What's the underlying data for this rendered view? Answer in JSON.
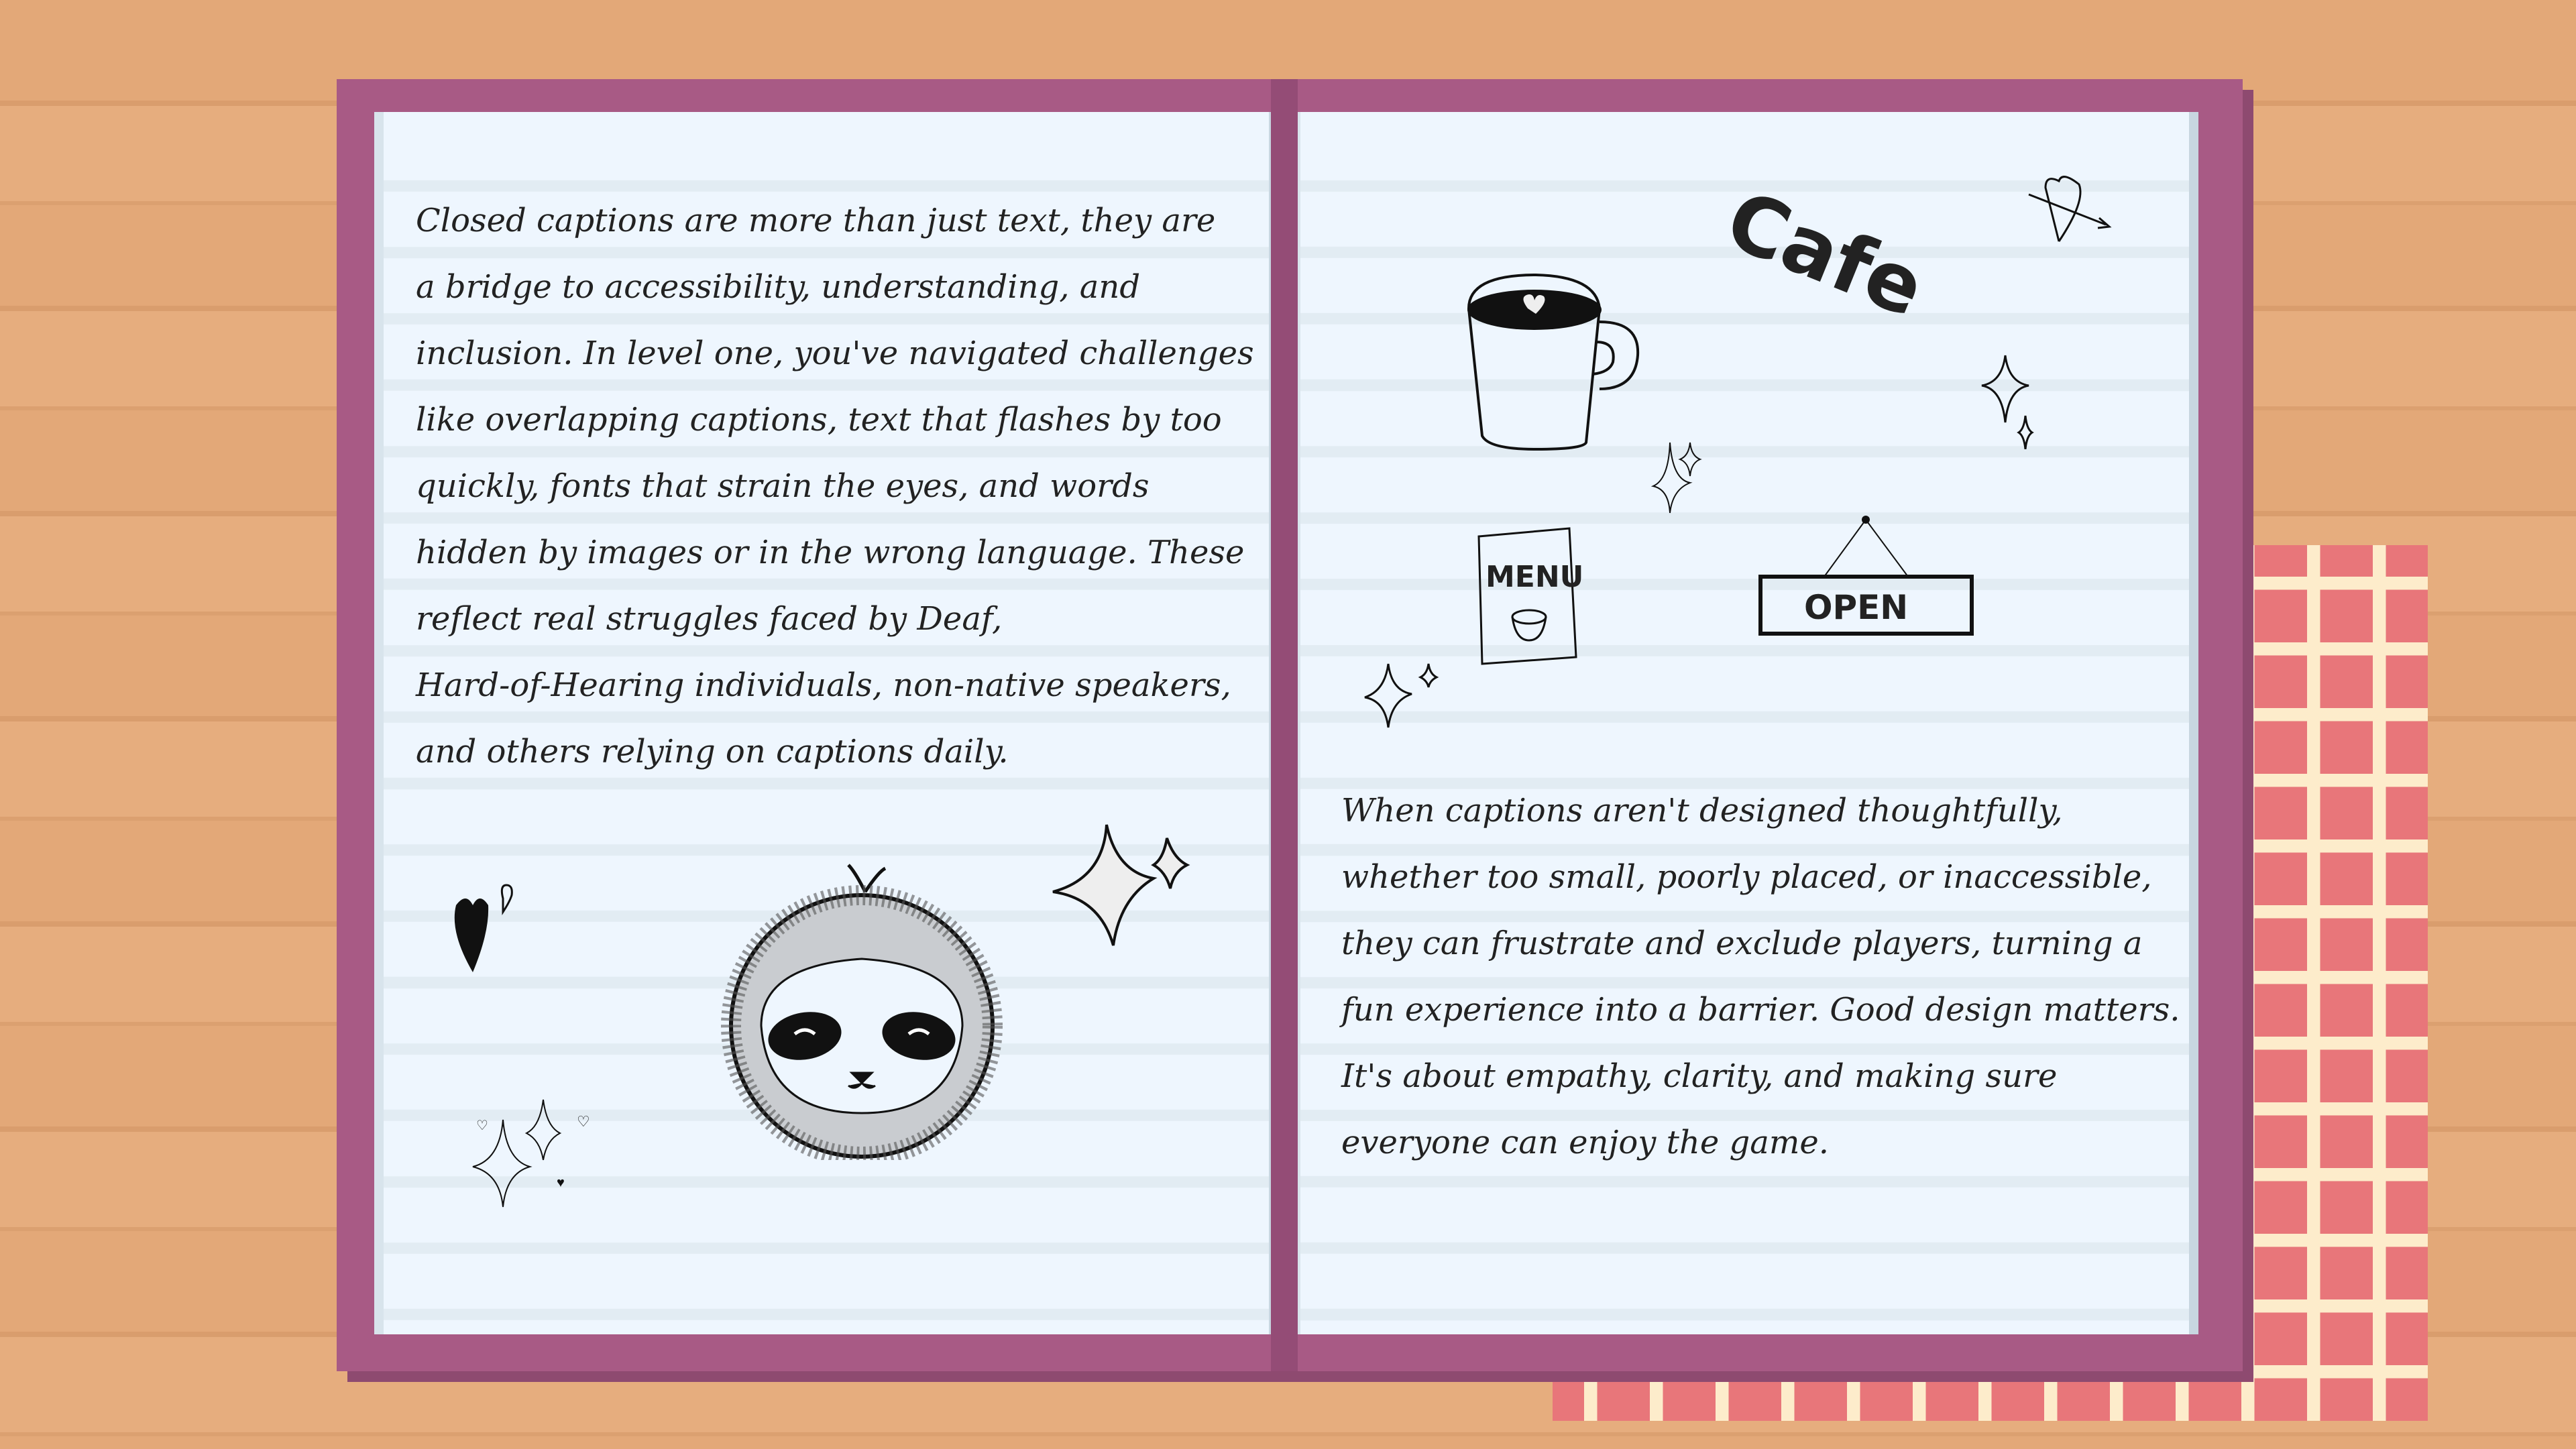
{
  "left_page": {
    "lines": [
      "Closed captions are more than just text, they are",
      "a bridge to accessibility, understanding, and",
      "inclusion. In level one, you've navigated challenges",
      "like overlapping captions, text that flashes by too",
      "quickly, fonts that strain the eyes, and words",
      "hidden by images or in the wrong language. These",
      "reflect real struggles faced by Deaf,",
      "Hard-of-Hearing individuals, non-native speakers,",
      "and others relying on captions daily."
    ]
  },
  "right_page": {
    "lines": [
      "When captions aren't designed thoughtfully,",
      "whether too small, poorly placed, or inaccessible,",
      "they can frustrate and exclude players, turning a",
      "fun experience into a barrier. Good design matters.",
      "It's about empathy, clarity, and making sure",
      "everyone can enjoy the game."
    ],
    "doodles": {
      "cafe": "Cafe",
      "menu": "MENU",
      "open": "OPEN"
    }
  },
  "colors": {
    "wood": "#e3a878",
    "cover": "#a85a85",
    "page": "#eef6fe",
    "cloth_red": "#e8767a",
    "cloth_cream": "#fdeccb"
  }
}
